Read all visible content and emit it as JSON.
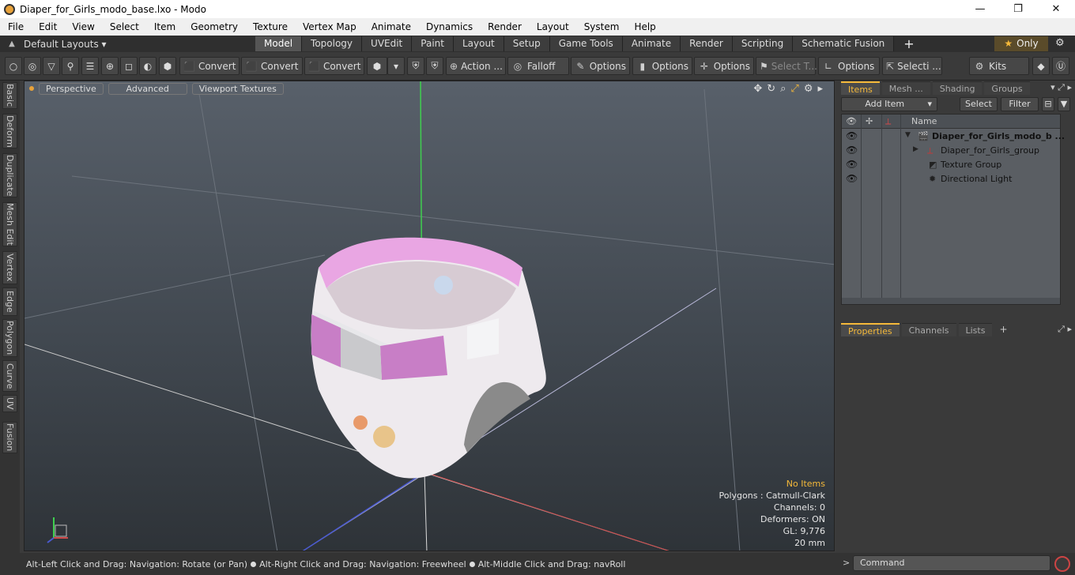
{
  "window": {
    "title": "Diaper_for_Girls_modo_base.lxo - Modo",
    "controls": [
      "—",
      "❐",
      "✕"
    ]
  },
  "menu": [
    "File",
    "Edit",
    "View",
    "Select",
    "Item",
    "Geometry",
    "Texture",
    "Vertex Map",
    "Animate",
    "Dynamics",
    "Render",
    "Layout",
    "System",
    "Help"
  ],
  "layoutbar": {
    "default_layouts": "Default Layouts ▾",
    "tabs": [
      "Model",
      "Topology",
      "UVEdit",
      "Paint",
      "Layout",
      "Setup",
      "Game Tools",
      "Animate",
      "Render",
      "Scripting",
      "Schematic Fusion"
    ],
    "active_tab": "Model",
    "only": "Only"
  },
  "toolbar": {
    "convert": "Convert",
    "action": "Action ...",
    "falloff": "Falloff",
    "options": "Options",
    "select_t": "Select T...",
    "selecti": "Selecti ...",
    "kits": "Kits"
  },
  "left_tabs": [
    "Basic",
    "Deform",
    "Duplicate",
    "Mesh Edit",
    "Vertex",
    "Edge",
    "Polygon",
    "Curve",
    "UV",
    "Fusion"
  ],
  "viewport": {
    "perspective": "Perspective",
    "advanced": "Advanced",
    "viewport_textures": "Viewport Textures",
    "info": {
      "no_items": "No Items",
      "polygons": "Polygons : Catmull-Clark",
      "channels": "Channels: 0",
      "deformers": "Deformers: ON",
      "gl": "GL: 9,776",
      "scale": "20 mm"
    }
  },
  "status": {
    "part1": "Alt-Left Click and Drag: Navigation: Rotate (or Pan)",
    "part2": "Alt-Right Click and Drag: Navigation: Freewheel",
    "part3": "Alt-Middle Click and Drag: navRoll"
  },
  "items_panel": {
    "tabs": [
      "Items",
      "Mesh ...",
      "Shading",
      "Groups"
    ],
    "active_tab": "Items",
    "add_item": "Add Item",
    "select": "Select",
    "filter": "Filter",
    "name_col": "Name",
    "rows": [
      {
        "name": "Diaper_for_Girls_modo_b ...",
        "icon": "🎬",
        "bold": true
      },
      {
        "name": "Diaper_for_Girls_group",
        "icon": "⟂",
        "bold": false
      },
      {
        "name": "Texture Group",
        "icon": "◩",
        "bold": false
      },
      {
        "name": "Directional Light",
        "icon": "✹",
        "bold": false
      }
    ]
  },
  "props_panel": {
    "tabs": [
      "Properties",
      "Channels",
      "Lists"
    ],
    "active_tab": "Properties"
  },
  "command": {
    "placeholder": "Command"
  },
  "colors": {
    "accent": "#f5b93a",
    "viewport_top": "#58606a",
    "viewport_bottom": "#2e3338"
  }
}
